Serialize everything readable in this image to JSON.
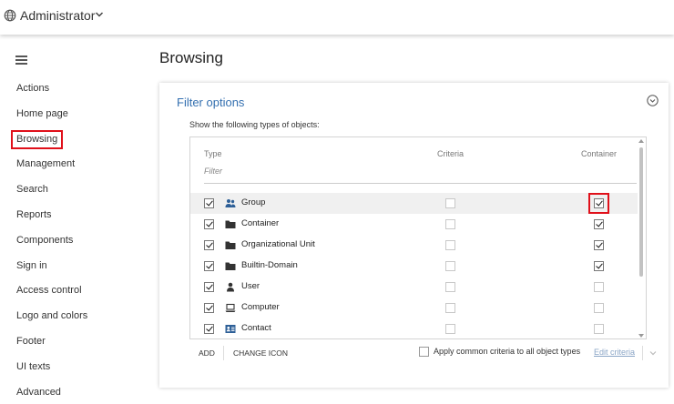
{
  "topbar": {
    "user_label": "Administrator"
  },
  "nav": {
    "items": [
      "Actions",
      "Home page",
      "Browsing",
      "Management",
      "Search",
      "Reports",
      "Components",
      "Sign in",
      "Access control",
      "Logo and colors",
      "Footer",
      "UI texts",
      "Advanced"
    ],
    "selected": "Browsing"
  },
  "page": {
    "title": "Browsing"
  },
  "card": {
    "title": "Filter options",
    "subtitle": "Show the following types of objects:",
    "headers": {
      "type": "Type",
      "criteria": "Criteria",
      "container": "Container"
    },
    "filter_placeholder": "Filter",
    "rows": [
      {
        "label": "Group",
        "icon": "group-icon",
        "selected": true,
        "criteria": false,
        "container": true
      },
      {
        "label": "Container",
        "icon": "folder-icon",
        "selected": true,
        "criteria": false,
        "container": true
      },
      {
        "label": "Organizational Unit",
        "icon": "folder-icon",
        "selected": true,
        "criteria": false,
        "container": true
      },
      {
        "label": "Builtin-Domain",
        "icon": "folder-icon",
        "selected": true,
        "criteria": false,
        "container": true
      },
      {
        "label": "User",
        "icon": "user-icon",
        "selected": true,
        "criteria": false,
        "container": false
      },
      {
        "label": "Computer",
        "icon": "computer-icon",
        "selected": true,
        "criteria": false,
        "container": false
      },
      {
        "label": "Contact",
        "icon": "contact-icon",
        "selected": true,
        "criteria": false,
        "container": false
      }
    ],
    "footer": {
      "add_label": "ADD",
      "change_icon_label": "CHANGE ICON",
      "apply_label": "Apply common criteria to all object types",
      "edit_label": "Edit criteria"
    }
  },
  "colors": {
    "accent": "#3470b0",
    "highlight": "#e0101a",
    "row_highlight": "#f0f0f0"
  }
}
